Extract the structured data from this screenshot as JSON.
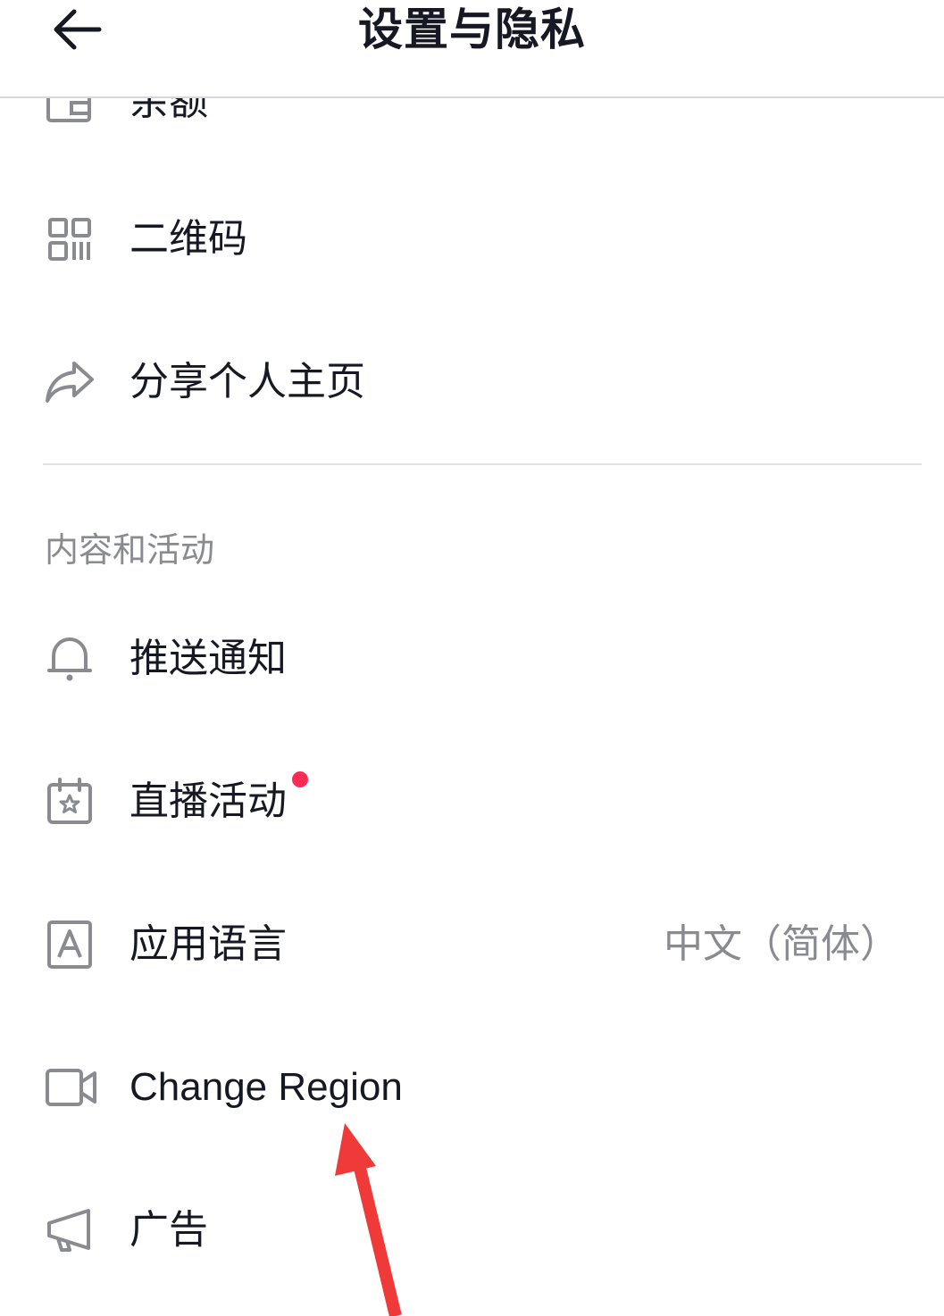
{
  "header": {
    "title": "设置与隐私",
    "back_icon": "arrow-left-icon"
  },
  "rows": [
    {
      "label": "余额",
      "icon": "wallet-icon"
    },
    {
      "label": "二维码",
      "icon": "qr-code-icon"
    },
    {
      "label": "分享个人主页",
      "icon": "share-icon"
    }
  ],
  "section": {
    "title": "内容和活动",
    "items": [
      {
        "label": "推送通知",
        "icon": "bell-icon"
      },
      {
        "label": "直播活动",
        "icon": "calendar-star-icon",
        "badge": "red-dot"
      },
      {
        "label": "应用语言",
        "icon": "letter-a-icon",
        "value": "中文（简体）"
      },
      {
        "label": "Change Region",
        "icon": "video-camera-icon"
      },
      {
        "label": "广告",
        "icon": "megaphone-icon"
      }
    ]
  },
  "colors": {
    "accent_dot": "#fe2c55",
    "annotation_arrow": "#f03a3a",
    "text_primary": "#161823",
    "text_secondary": "#8a8b91"
  }
}
